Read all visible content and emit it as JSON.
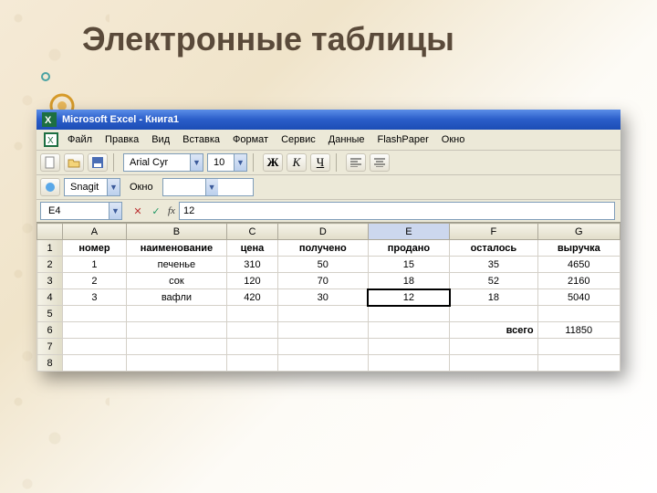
{
  "slide_title": "Электронные таблицы",
  "titlebar": "Microsoft Excel - Книга1",
  "menu": [
    "Файл",
    "Правка",
    "Вид",
    "Вставка",
    "Формат",
    "Сервис",
    "Данные",
    "FlashPaper",
    "Окно"
  ],
  "toolbar": {
    "new_icon": "new",
    "open_icon": "open",
    "save_icon": "save",
    "font_name": "Arial Cyr",
    "font_size": "10",
    "bold": "Ж",
    "italic": "К",
    "underline": "Ч"
  },
  "snagit": {
    "label": "Snagit",
    "button": "Окно"
  },
  "cell_ref": {
    "name": "E4",
    "formula": "12"
  },
  "columns": [
    "A",
    "B",
    "C",
    "D",
    "E",
    "F",
    "G"
  ],
  "headers": {
    "A": "номер",
    "B": "наименование",
    "C": "цена",
    "D": "получено",
    "E": "продано",
    "F": "осталось",
    "G": "выручка"
  },
  "rows": [
    {
      "n": "1",
      "A": "1",
      "B": "печенье",
      "C": "310",
      "D": "50",
      "E": "15",
      "F": "35",
      "G": "4650"
    },
    {
      "n": "2",
      "A": "2",
      "B": "сок",
      "C": "120",
      "D": "70",
      "E": "18",
      "F": "52",
      "G": "2160"
    },
    {
      "n": "3",
      "A": "3",
      "B": "вафли",
      "C": "420",
      "D": "30",
      "E": "12",
      "F": "18",
      "G": "5040"
    }
  ],
  "total": {
    "label": "всего",
    "value": "11850"
  },
  "row_numbers": [
    "1",
    "2",
    "3",
    "4",
    "5",
    "6",
    "7",
    "8"
  ]
}
